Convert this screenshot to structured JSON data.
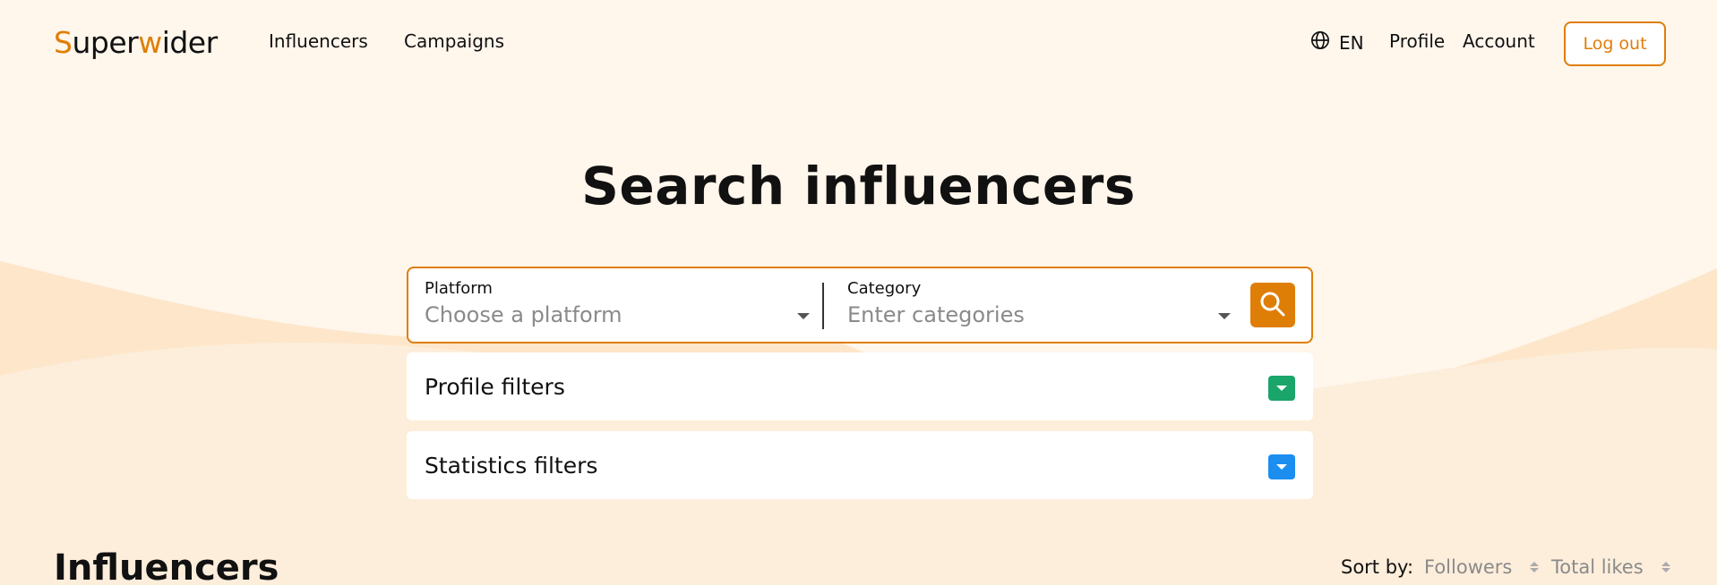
{
  "brand": {
    "name_part1": "S",
    "name_part2": "uper",
    "name_part3": "w",
    "name_part4": "ider",
    "accent_color": "#df7e07"
  },
  "nav": {
    "influencers": "Influencers",
    "campaigns": "Campaigns",
    "language": "EN",
    "language_icon": "globe-icon",
    "profile": "Profile",
    "account": "Account",
    "logout": "Log out"
  },
  "hero": {
    "title": "Search influencers"
  },
  "search": {
    "platform_label": "Platform",
    "platform_placeholder": "Choose a platform",
    "category_label": "Category",
    "category_placeholder": "Enter categories",
    "button_icon": "search-icon"
  },
  "filters": {
    "profile_title": "Profile filters",
    "profile_toggle_color": "#1aa56b",
    "stats_title": "Statistics filters",
    "stats_toggle_color": "#1b8ef0"
  },
  "results": {
    "title": "Influencers",
    "sort_label": "Sort by:",
    "sort_options": [
      "Followers",
      "Total likes"
    ]
  },
  "colors": {
    "background": "#fff6ec",
    "wave": "#fde3c4",
    "text": "#111111",
    "muted": "#8a8a8a"
  }
}
